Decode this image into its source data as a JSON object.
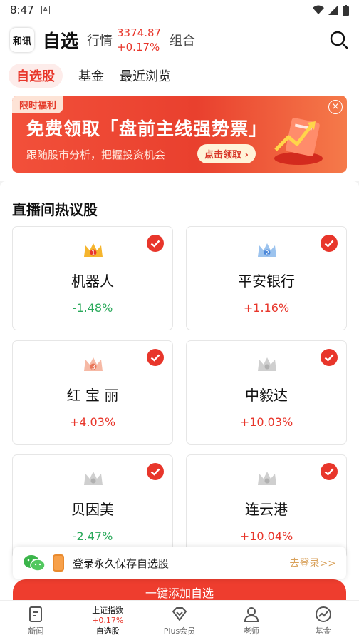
{
  "status": {
    "time": "8:47"
  },
  "header": {
    "logo_text": "和讯",
    "title": "自选",
    "nav_market": "行情",
    "index_value": "3374.87",
    "index_change": "+0.17%",
    "nav_portfolio": "组合"
  },
  "tabs": [
    "自选股",
    "基金",
    "最近浏览"
  ],
  "banner": {
    "tag": "限时福利",
    "headline_a": "免费领取",
    "headline_b": "「盘前主线强势票」",
    "sub": "跟随股市分析，把握投资机会",
    "cta": "点击领取 ›",
    "close": "×"
  },
  "section": {
    "title": "直播间热议股"
  },
  "stocks": [
    {
      "name": "机器人",
      "change": "-1.48%",
      "rank": "1",
      "crown": "gold"
    },
    {
      "name": "平安银行",
      "change": "+1.16%",
      "rank": "2",
      "crown": "blue"
    },
    {
      "name": "红 宝 丽",
      "change": "+4.03%",
      "rank": "3",
      "crown": "bronze"
    },
    {
      "name": "中毅达",
      "change": "+10.03%",
      "rank": "",
      "crown": "grey"
    },
    {
      "name": "贝因美",
      "change": "-2.47%",
      "rank": "",
      "crown": "grey"
    },
    {
      "name": "连云港",
      "change": "+10.04%",
      "rank": "",
      "crown": "grey"
    }
  ],
  "login_bar": {
    "text": "登录永久保存自选股",
    "link": "去登录>>"
  },
  "add_button": "一键添加自选",
  "tabbar": {
    "news": "新闻",
    "index_name": "上证指数",
    "index_change": "+0.17%",
    "watchlist": "自选股",
    "plus": "Plus会员",
    "teacher": "老师",
    "fund": "基金"
  },
  "colors": {
    "accent": "#e8362b",
    "up": "#e8362b",
    "down": "#2aa95b"
  }
}
